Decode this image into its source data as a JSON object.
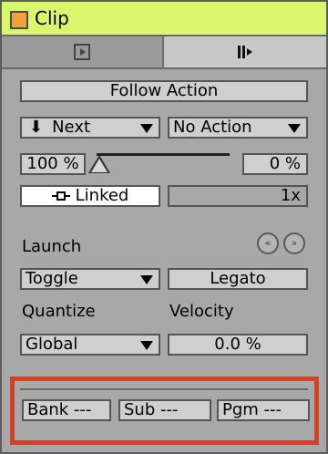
{
  "title": "Clip",
  "colors": {
    "titlebar": "#d8f76b",
    "clip_color": "#f2a23b",
    "highlight": "#e53b1c"
  },
  "tabs": [
    {
      "icon": "play-triangle-icon"
    },
    {
      "icon": "follow-action-icon"
    }
  ],
  "follow_action": {
    "header": "Follow Action",
    "action_a": {
      "arrow": "⬇",
      "label": "Next"
    },
    "action_b": "No Action",
    "chance_a": "100 %",
    "chance_b": "0 %",
    "linked": "Linked",
    "multiplier": "1x",
    "chance_a_fraction": 1.0
  },
  "launch": {
    "label": "Launch",
    "mode": "Toggle",
    "legato": "Legato",
    "quantize_label": "Quantize",
    "velocity_label": "Velocity",
    "quantize": "Global",
    "velocity": "0.0 %"
  },
  "nav_buttons": {
    "prev": "«",
    "next": "»"
  },
  "program_change": {
    "bank": "Bank ---",
    "sub": "Sub ---",
    "pgm": "Pgm ---"
  }
}
